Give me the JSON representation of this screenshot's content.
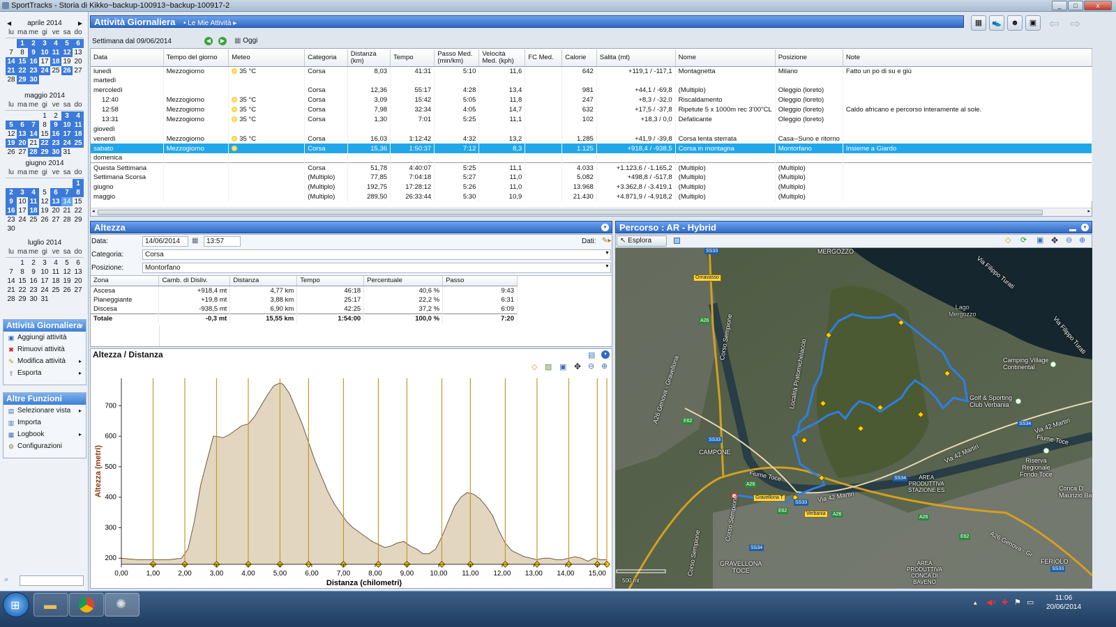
{
  "window": {
    "title": "SportTracks - Storia di Kikko~backup-100913~backup-100917-2",
    "min": "_",
    "max": "□",
    "close": "x"
  },
  "calendar": {
    "daynames": [
      "lu",
      "ma",
      "me",
      "gi",
      "ve",
      "sa",
      "do"
    ],
    "months": [
      {
        "name": "aprile 2014",
        "days": [
          "",
          "1",
          "2",
          "3",
          "4",
          "5",
          "6",
          "7",
          "8",
          "9",
          "10",
          "11",
          "12",
          "13",
          "14",
          "15",
          "16",
          "17",
          "18",
          "19",
          "20",
          "21",
          "22",
          "23",
          "24",
          "25",
          "26",
          "27",
          "28",
          "29",
          "30",
          "",
          "",
          "",
          "",
          ""
        ]
      },
      {
        "name": "maggio 2014",
        "days": [
          "",
          "",
          "",
          "1",
          "2",
          "3",
          "4",
          "5",
          "6",
          "7",
          "8",
          "9",
          "10",
          "11",
          "12",
          "13",
          "14",
          "15",
          "16",
          "17",
          "18",
          "19",
          "20",
          "21",
          "22",
          "23",
          "24",
          "25",
          "26",
          "27",
          "28",
          "29",
          "30",
          "31",
          "",
          ""
        ]
      },
      {
        "name": "giugno 2014",
        "days": [
          "",
          "",
          "",
          "",
          "",
          "",
          "1",
          "2",
          "3",
          "4",
          "5",
          "6",
          "7",
          "8",
          "9",
          "10",
          "11",
          "12",
          "13",
          "14",
          "15",
          "16",
          "17",
          "18",
          "19",
          "20",
          "21",
          "22",
          "23",
          "24",
          "25",
          "26",
          "27",
          "28",
          "29",
          "30"
        ]
      },
      {
        "name": "luglio 2014",
        "days": [
          "",
          "1",
          "2",
          "3",
          "4",
          "5",
          "6",
          "7",
          "8",
          "9",
          "10",
          "11",
          "12",
          "13",
          "14",
          "15",
          "16",
          "17",
          "18",
          "19",
          "20",
          "21",
          "22",
          "23",
          "24",
          "25",
          "26",
          "27",
          "28",
          "29",
          "30",
          "31",
          "",
          "",
          "",
          ""
        ]
      }
    ]
  },
  "sidebar": {
    "activity_title": "Attività Giornaliera",
    "activity_items": [
      "Aggiungi attività",
      "Rimuovi attività",
      "Modifica attività",
      "Esporta"
    ],
    "functions_title": "Altre Funzioni",
    "function_items": [
      "Selezionare vista",
      "Importa",
      "Logbook",
      "Configurazioni"
    ]
  },
  "main": {
    "title": "Attività Giornaliera",
    "crumb": "Le Mie Attività",
    "week_label": "Settimana dal 09/06/2014",
    "today_label": "Oggi"
  },
  "activities": {
    "columns": [
      "Data",
      "Tempo del giorno",
      "Meteo",
      "Categoria",
      "Distanza (km)",
      "Tempo",
      "Passo Med. (min/km)",
      "Velocità Med. (kph)",
      "FC Med.",
      "Calorie",
      "Salita (mt)",
      "Nome",
      "Posizione",
      "Note"
    ],
    "rows": [
      {
        "d": "lunedì",
        "t": "Mezzogiorno",
        "m": "35 °C",
        "sun": true,
        "c": "Corsa",
        "km": "8,03",
        "tm": "41:31",
        "p": "5:10",
        "v": "11,6",
        "fc": "",
        "cal": "642",
        "s": "+119,1 / -117,1",
        "n": "Montagnetta",
        "pos": "Milano",
        "note": "Fatto un po di su e giù"
      },
      {
        "d": "martedì",
        "t": "",
        "m": "",
        "sun": false,
        "c": "",
        "km": "",
        "tm": "",
        "p": "",
        "v": "",
        "fc": "",
        "cal": "",
        "s": "",
        "n": "",
        "pos": "",
        "note": ""
      },
      {
        "d": "mercoledì",
        "t": "",
        "m": "",
        "sun": false,
        "c": "Corsa",
        "km": "12,36",
        "tm": "55:17",
        "p": "4:28",
        "v": "13,4",
        "fc": "",
        "cal": "981",
        "s": "+44,1 / -69,8",
        "n": "(Multiplo)",
        "pos": "Oleggio (loreto)",
        "note": ""
      },
      {
        "d": "12:40",
        "t": "Mezzogiorno",
        "m": "35 °C",
        "sun": true,
        "c": "Corsa",
        "km": "3,09",
        "tm": "15:42",
        "p": "5:05",
        "v": "11,8",
        "fc": "",
        "cal": "247",
        "s": "+8,3 / -32,0",
        "n": "Riscaldamento",
        "pos": "Oleggio (loreto)",
        "note": "",
        "indent": true
      },
      {
        "d": "12:58",
        "t": "Mezzogiorno",
        "m": "35 °C",
        "sun": true,
        "c": "Corsa",
        "km": "7,98",
        "tm": "32:34",
        "p": "4:05",
        "v": "14,7",
        "fc": "",
        "cal": "632",
        "s": "+17,5 / -37,8",
        "n": "Ripetute 5 x 1000m rec 3'00\"CL",
        "pos": "Oleggio (loreto)",
        "note": "Caldo africano e percorso interamente al sole.",
        "indent": true
      },
      {
        "d": "13:31",
        "t": "Mezzogiorno",
        "m": "35 °C",
        "sun": true,
        "c": "Corsa",
        "km": "1,30",
        "tm": "7:01",
        "p": "5:25",
        "v": "11,1",
        "fc": "",
        "cal": "102",
        "s": "+18,3 / 0,0",
        "n": "Defaticante",
        "pos": "Oleggio (loreto)",
        "note": "",
        "indent": true
      },
      {
        "d": "giovedì",
        "t": "",
        "m": "",
        "sun": false,
        "c": "",
        "km": "",
        "tm": "",
        "p": "",
        "v": "",
        "fc": "",
        "cal": "",
        "s": "",
        "n": "",
        "pos": "",
        "note": ""
      },
      {
        "d": "venerdì",
        "t": "Mezzogiorno",
        "m": "35 °C",
        "sun": true,
        "c": "Corsa",
        "km": "16,03",
        "tm": "1:12:42",
        "p": "4:32",
        "v": "13,2",
        "fc": "",
        "cal": "1.285",
        "s": "+41,9 / -39,8",
        "n": "Corsa lenta sterrata",
        "pos": "Casa--Suno e ritorno",
        "note": ""
      },
      {
        "d": "sabato",
        "t": "Mezzogiorno",
        "m": "",
        "sun": true,
        "c": "Corsa",
        "km": "15,36",
        "tm": "1:50:37",
        "p": "7:12",
        "v": "8,3",
        "fc": "",
        "cal": "1.125",
        "s": "+918,4 / -938,5",
        "n": "Corsa in montagna",
        "pos": "Montorfano",
        "note": "Insieme a Giardo",
        "selected": true
      },
      {
        "d": "domenica",
        "t": "",
        "m": "",
        "sun": false,
        "c": "",
        "km": "",
        "tm": "",
        "p": "",
        "v": "",
        "fc": "",
        "cal": "",
        "s": "",
        "n": "",
        "pos": "",
        "note": ""
      }
    ],
    "totals": [
      {
        "d": "Questa Settimana",
        "c": "Corsa",
        "km": "51,78",
        "tm": "4:40:07",
        "p": "5:25",
        "v": "11,1",
        "cal": "4.033",
        "s": "+1.123,6 / -1.165,2",
        "n": "(Multiplo)",
        "pos": "(Multiplo)"
      },
      {
        "d": "Settimana Scorsa",
        "c": "(Multiplo)",
        "km": "77,85",
        "tm": "7:04:18",
        "p": "5:27",
        "v": "11,0",
        "cal": "5.082",
        "s": "+498,8 / -517,8",
        "n": "(Multiplo)",
        "pos": "(Multiplo)"
      },
      {
        "d": "giugno",
        "c": "(Multiplo)",
        "km": "192,75",
        "tm": "17:28:12",
        "p": "5:26",
        "v": "11,0",
        "cal": "13.968",
        "s": "+3.362,8 / -3.419,1",
        "n": "(Multiplo)",
        "pos": "(Multiplo)"
      },
      {
        "d": "maggio",
        "c": "(Multiplo)",
        "km": "289,50",
        "tm": "26:33:44",
        "p": "5:30",
        "v": "10,9",
        "cal": "21.430",
        "s": "+4.871,9 / -4.918,2",
        "n": "(Multiplo)",
        "pos": "(Multiplo)"
      }
    ]
  },
  "altezza": {
    "title": "Altezza",
    "data_label": "Data:",
    "date": "14/06/2014",
    "time": "13:57",
    "dati_label": "Dati:",
    "cat_label": "Categoria:",
    "category": "Corsa",
    "pos_label": "Posizione:",
    "position": "Montorfano",
    "zone_columns": [
      "Zona",
      "Camb. di Disliv.",
      "Distanza",
      "Tempo",
      "Percentuale",
      "Passo"
    ],
    "zones": [
      {
        "z": "Ascesa",
        "c": "+918,4 mt",
        "d": "4,77 km",
        "t": "46:18",
        "p": "40,6 %",
        "s": "9:43"
      },
      {
        "z": "Pianeggiante",
        "c": "+19,8 mt",
        "d": "3,88 km",
        "t": "25:17",
        "p": "22,2 %",
        "s": "6:31"
      },
      {
        "z": "Discesa",
        "c": "-938,5 mt",
        "d": "6,90 km",
        "t": "42:25",
        "p": "37,2 %",
        "s": "6:09"
      },
      {
        "z": "Totale",
        "c": "-0,3 mt",
        "d": "15,55 km",
        "t": "1:54:00",
        "p": "100,0 %",
        "s": "7:20"
      }
    ]
  },
  "chart_data": {
    "type": "area",
    "title": "Altezza / Distanza",
    "xlabel": "Distanza (chilometri)",
    "ylabel": "Altezza (metri)",
    "xlim": [
      0,
      15.3
    ],
    "ylim": [
      180,
      790
    ],
    "xticks": [
      "0,00",
      "1,00",
      "2,00",
      "3,00",
      "4,00",
      "5,00",
      "6,00",
      "7,00",
      "8,00",
      "9,00",
      "10,00",
      "11,00",
      "12,00",
      "13,00",
      "14,00",
      "15,00"
    ],
    "yticks": [
      200,
      300,
      400,
      500,
      600,
      700
    ],
    "x": [
      0,
      0.5,
      1.0,
      1.5,
      1.9,
      2.1,
      2.3,
      2.5,
      2.7,
      2.9,
      3.0,
      3.2,
      3.4,
      3.6,
      3.8,
      4.0,
      4.2,
      4.4,
      4.6,
      4.8,
      5.0,
      5.1,
      5.3,
      5.5,
      5.7,
      5.9,
      6.1,
      6.3,
      6.5,
      6.7,
      6.9,
      7.1,
      7.3,
      7.5,
      7.7,
      7.9,
      8.1,
      8.3,
      8.5,
      8.7,
      8.9,
      9.1,
      9.3,
      9.5,
      9.7,
      9.9,
      10.1,
      10.3,
      10.5,
      10.7,
      10.9,
      11.1,
      11.3,
      11.5,
      11.7,
      11.9,
      12.1,
      12.3,
      12.5,
      12.7,
      12.9,
      13.1,
      13.3,
      13.5,
      13.7,
      13.9,
      14.1,
      14.3,
      14.5,
      14.7,
      14.9,
      15.1,
      15.3
    ],
    "y": [
      200,
      195,
      195,
      195,
      200,
      230,
      320,
      440,
      520,
      600,
      600,
      595,
      605,
      620,
      635,
      640,
      665,
      700,
      735,
      765,
      775,
      770,
      740,
      690,
      640,
      580,
      520,
      470,
      420,
      380,
      350,
      320,
      300,
      285,
      270,
      255,
      245,
      235,
      240,
      250,
      255,
      240,
      230,
      215,
      215,
      230,
      270,
      320,
      370,
      400,
      415,
      410,
      395,
      370,
      340,
      290,
      250,
      225,
      215,
      205,
      200,
      195,
      200,
      200,
      195,
      195,
      200,
      205,
      200,
      190,
      200,
      195,
      195
    ],
    "markers": [
      1.0,
      2.0,
      3.0,
      4.0,
      5.0,
      5.9,
      7.0,
      8.1,
      9.0,
      10.1,
      11.0,
      12.1,
      13.1,
      14.1,
      15.0,
      15.3
    ]
  },
  "map": {
    "title": "Percorso  : AR - Hybrid",
    "explore": "Esplora",
    "labels": {
      "lago": "Lago\nMergozzo",
      "camping": "Camping Village\nContinental",
      "golf": "Golf & Sporting\nClub Verbania",
      "fiume1": "Fiume Toce",
      "fiume2": "Fiume Toce",
      "riserva": "Riserva\nRegionale\nFondo Toce",
      "conca": "Conca D'\nMaurizio Battaglia",
      "gravellona": "A26 Genova - Gravellona",
      "campone": "CAMPONE",
      "mergozzo": "MERGOZZO",
      "via42a": "Via 42 Martiri",
      "via42b": "Via 42 Martiri",
      "via42c": "Via 42 Martiri",
      "viaturati": "Via Filippo Turati",
      "viaturati2": "Via Filippo Turati",
      "sempione": "Corso Sempione",
      "sempione2": "Corso Sempione",
      "sempione3": "Corso Sempione",
      "pratomichelaccio": "Località Pratomichelaccio",
      "area1": "AREA\nPRODUTTIVA\nSTAZIONE ES",
      "area2": "AREA\nPRODUTTIVA\nCONCA DI\nBAVENO",
      "gravelbottom": "GRAVELLONA\nTOCE",
      "a26bottom": "A26 Genova - Gr",
      "feriolo": "FERIOLO",
      "scale": "500 mt"
    },
    "tags": {
      "ornavasso": "Ornavasso",
      "gravellona": "Gravellona T",
      "verbania": "Verbania",
      "ss33a": "SS33",
      "ss33b": "SS33",
      "ss33c": "SS33",
      "ss34a": "SS34",
      "ss34b": "SS34",
      "ss34c": "SS34",
      "ss33d": "SS33",
      "a26a": "A26",
      "a26b": "A26",
      "a26c": "A26",
      "a26d": "A26",
      "e62a": "E62",
      "e62b": "E62",
      "e62c": "E62"
    }
  },
  "taskbar": {
    "time": "11:06",
    "date": "20/06/2014"
  },
  "colors": {
    "accent": "#3f7fd6",
    "selection": "#21a6ea",
    "route": "#2f7fe0",
    "elev_fill": "#e3d6c0",
    "elev_line": "#6b5a40"
  }
}
